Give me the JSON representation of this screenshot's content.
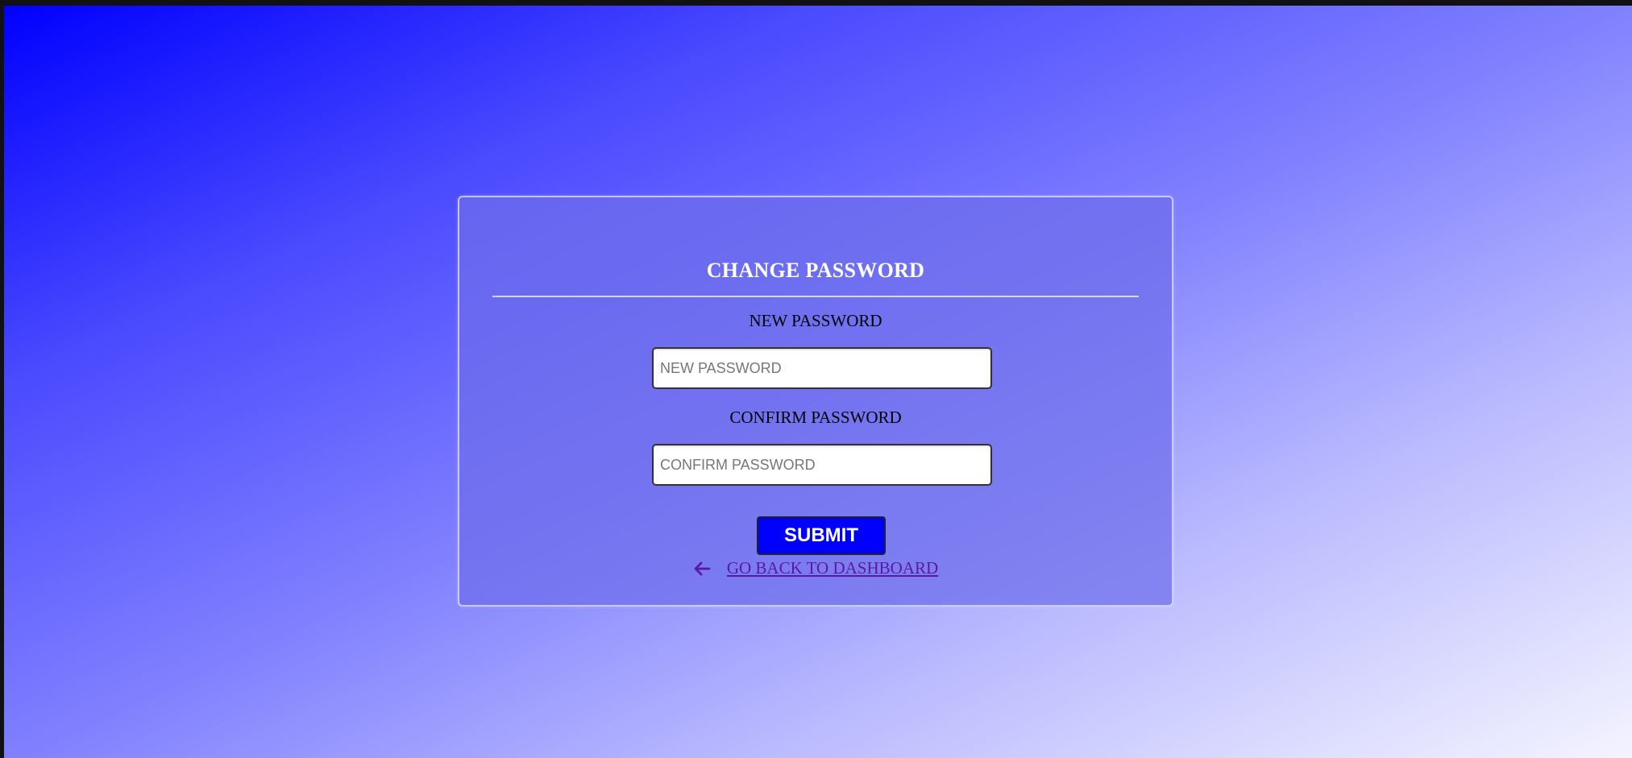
{
  "form": {
    "title": "CHANGE PASSWORD",
    "new_password": {
      "label": "NEW PASSWORD",
      "placeholder": "NEW PASSWORD",
      "value": ""
    },
    "confirm_password": {
      "label": "CONFIRM PASSWORD",
      "placeholder": "CONFIRM PASSWORD",
      "value": ""
    },
    "submit_label": "SUBMIT",
    "back_link": {
      "icon": "arrow-left-icon",
      "label": "GO BACK TO DASHBOARD"
    }
  },
  "colors": {
    "gradient_start": "#0000ff",
    "gradient_end": "#f4f4ff",
    "submit_background": "#0000ff",
    "link_color": "#5a1aa0"
  }
}
